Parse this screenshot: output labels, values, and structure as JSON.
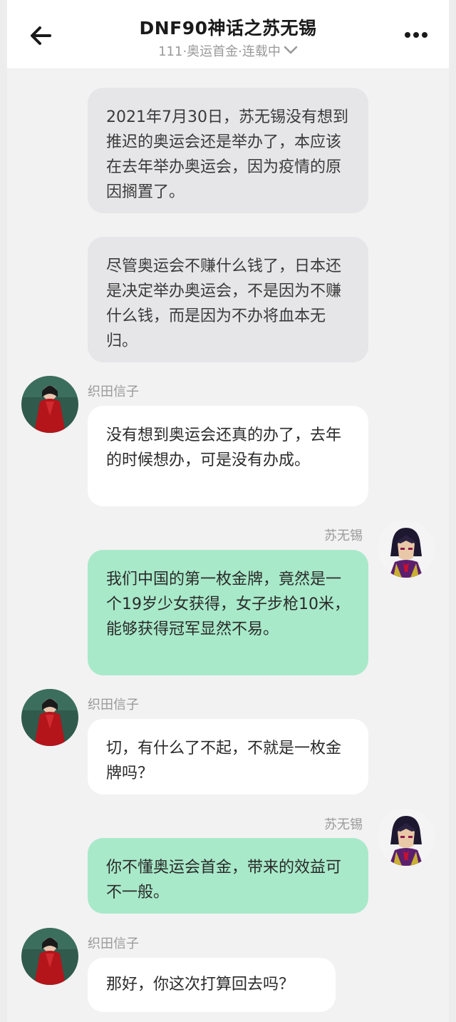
{
  "header": {
    "title": "DNF90神话之苏无锡",
    "subtitle": "111·奥运首金·连载中"
  },
  "colors": {
    "background": "#f2f2f3",
    "narration_bubble": "#e6e6e8",
    "left_bubble": "#ffffff",
    "right_bubble": "#a8e9c9",
    "name_text": "#9a9a9a"
  },
  "icons": {
    "back": "arrow-left-icon",
    "more": "more-dots-icon",
    "chevron": "chevron-down-icon"
  },
  "messages": [
    {
      "kind": "narration",
      "text": "2021年7月30日，苏无锡没有想到推迟的奥运会还是举办了，本应该在去年举办奥运会，因为疫情的原因搁置了。"
    },
    {
      "kind": "narration",
      "text": "尽管奥运会不赚什么钱了，日本还是决定举办奥运会，不是因为不赚什么钱，而是因为不办将血本无归。"
    },
    {
      "kind": "left",
      "sender": "织田信子",
      "text": "没有想到奥运会还真的办了，去年的时候想办，可是没有办成。"
    },
    {
      "kind": "right",
      "sender": "苏无锡",
      "text": "我们中国的第一枚金牌，竟然是一个19岁少女获得，女子步枪10米，能够获得冠军显然不易。"
    },
    {
      "kind": "left",
      "sender": "织田信子",
      "text": "切，有什么了不起，不就是一枚金牌吗？"
    },
    {
      "kind": "right",
      "sender": "苏无锡",
      "text": "你不懂奥运会首金，带来的效益可不一般。"
    },
    {
      "kind": "left",
      "sender": "织田信子",
      "text": "那好，你这次打算回去吗？"
    }
  ]
}
